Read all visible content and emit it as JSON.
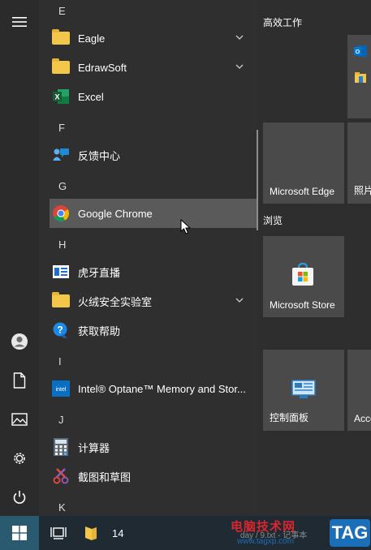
{
  "app_list": {
    "letter_e": "E",
    "eagle": "Eagle",
    "edrawsoft": "EdrawSoft",
    "excel": "Excel",
    "letter_f": "F",
    "feedback_hub": "反馈中心",
    "letter_g": "G",
    "google_chrome": "Google Chrome",
    "letter_h": "H",
    "huya": "虎牙直播",
    "huorong": "火绒安全实验室",
    "get_help": "获取帮助",
    "letter_i": "I",
    "intel_optane": "Intel® Optane™ Memory and Stor...",
    "letter_j": "J",
    "calculator": "计算器",
    "snip_sketch": "截图和草图",
    "letter_k": "K"
  },
  "tiles": {
    "group_productivity": "高效工作",
    "group_browse": "浏览",
    "edge": "Microsoft Edge",
    "photos": "照片",
    "store": "Microsoft Store",
    "control_panel": "控制面板",
    "accessories": "Acce"
  },
  "taskbar": {
    "folder_label": "14"
  },
  "watermark": {
    "line1": "电脑技术网",
    "line2": "www.tagxp.com",
    "tag": "TAG",
    "faded": "day / 9.txt - 记事本"
  },
  "colors": {
    "selected_row": "#5a5a5a",
    "folder": "#f3c84a",
    "tile": "#4a4a4a",
    "start_button": "#2a5a70",
    "watermark_red": "#d8262f",
    "watermark_blue": "#1b6fb8"
  }
}
